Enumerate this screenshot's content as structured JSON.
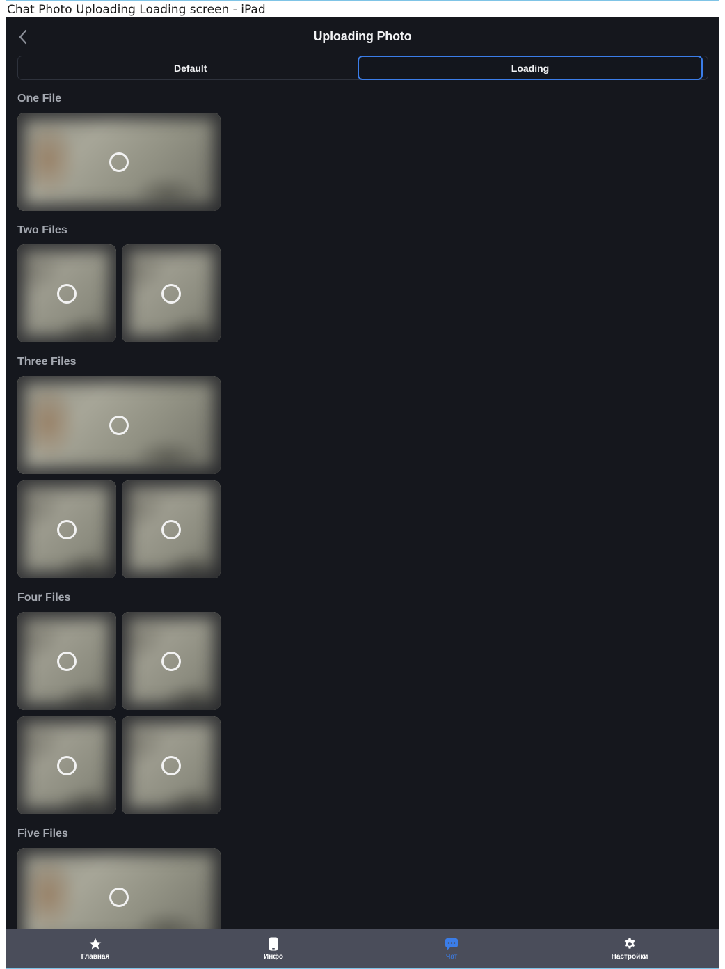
{
  "frame": {
    "title": "Chat Photo Uploading Loading screen - iPad"
  },
  "nav": {
    "title": "Uploading Photo",
    "back_icon": "chevron-left-icon"
  },
  "segmented": {
    "tabs": [
      {
        "label": "Default",
        "active": false
      },
      {
        "label": "Loading",
        "active": true
      }
    ]
  },
  "sections": [
    {
      "title": "One File",
      "file_count": 1
    },
    {
      "title": "Two Files",
      "file_count": 2
    },
    {
      "title": "Three Files",
      "file_count": 3
    },
    {
      "title": "Four Files",
      "file_count": 4
    },
    {
      "title": "Five Files",
      "file_count": 5
    }
  ],
  "tab_bar": {
    "items": [
      {
        "label": "Главная",
        "icon": "star-icon",
        "active": false
      },
      {
        "label": "Инфо",
        "icon": "phone-icon",
        "active": false
      },
      {
        "label": "Чат",
        "icon": "chat-bubble-icon",
        "active": true
      },
      {
        "label": "Настройки",
        "icon": "gear-icon",
        "active": false
      }
    ]
  },
  "colors": {
    "background": "#15171d",
    "accent": "#3b7de8",
    "tab_bar": "#4a4d5a",
    "text_primary": "#f2f3f5",
    "text_secondary": "#a4a8b0"
  }
}
